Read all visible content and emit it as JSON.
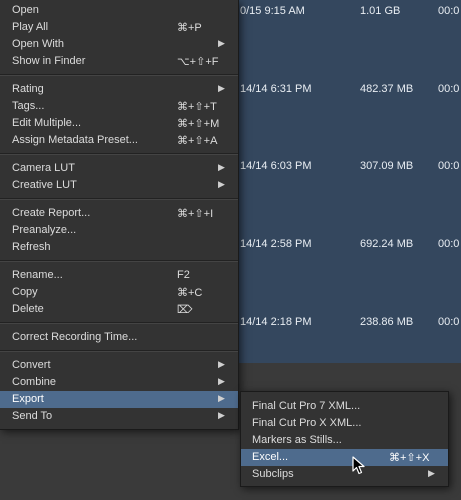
{
  "file_list": {
    "rows": [
      {
        "date": "0/15 9:15 AM",
        "size": "1.01 GB",
        "duration": "00:0"
      },
      {
        "date": "14/14 6:31 PM",
        "size": "482.37 MB",
        "duration": "00:0"
      },
      {
        "date": "14/14 6:03 PM",
        "size": "307.09 MB",
        "duration": "00:0"
      },
      {
        "date": "14/14 2:58 PM",
        "size": "692.24 MB",
        "duration": "00:0"
      },
      {
        "date": "14/14 2:18 PM",
        "size": "238.86 MB",
        "duration": "00:0"
      }
    ]
  },
  "context_menu": {
    "open": {
      "label": "Open"
    },
    "play_all": {
      "label": "Play All",
      "shortcut": "⌘+P"
    },
    "open_with": {
      "label": "Open With"
    },
    "show_in_finder": {
      "label": "Show in Finder",
      "shortcut": "⌥+⇧+F"
    },
    "rating": {
      "label": "Rating"
    },
    "tags": {
      "label": "Tags...",
      "shortcut": "⌘+⇧+T"
    },
    "edit_multiple": {
      "label": "Edit Multiple...",
      "shortcut": "⌘+⇧+M"
    },
    "assign_metadata_preset": {
      "label": "Assign Metadata Preset...",
      "shortcut": "⌘+⇧+A"
    },
    "camera_lut": {
      "label": "Camera LUT"
    },
    "creative_lut": {
      "label": "Creative LUT"
    },
    "create_report": {
      "label": "Create Report...",
      "shortcut": "⌘+⇧+I"
    },
    "preanalyze": {
      "label": "Preanalyze..."
    },
    "refresh": {
      "label": "Refresh"
    },
    "rename": {
      "label": "Rename...",
      "shortcut": "F2"
    },
    "copy": {
      "label": "Copy",
      "shortcut": "⌘+C"
    },
    "delete": {
      "label": "Delete",
      "shortcut": "⌦"
    },
    "correct_recording_time": {
      "label": "Correct Recording Time..."
    },
    "convert": {
      "label": "Convert"
    },
    "combine": {
      "label": "Combine"
    },
    "export": {
      "label": "Export"
    },
    "send_to": {
      "label": "Send To"
    }
  },
  "export_submenu": {
    "fcp7_xml": {
      "label": "Final Cut Pro 7 XML..."
    },
    "fcpx_xml": {
      "label": "Final Cut Pro X XML..."
    },
    "markers_as_stills": {
      "label": "Markers as Stills..."
    },
    "excel": {
      "label": "Excel...",
      "shortcut": "⌘+⇧+X"
    },
    "subclips": {
      "label": "Subclips"
    }
  },
  "icons": {
    "submenu_arrow": "chevron-right-icon",
    "cursor": "mouse-pointer-icon"
  },
  "colors": {
    "list_background": "#34475e",
    "menu_background": "#333333",
    "highlight": "#4e6b8d"
  }
}
